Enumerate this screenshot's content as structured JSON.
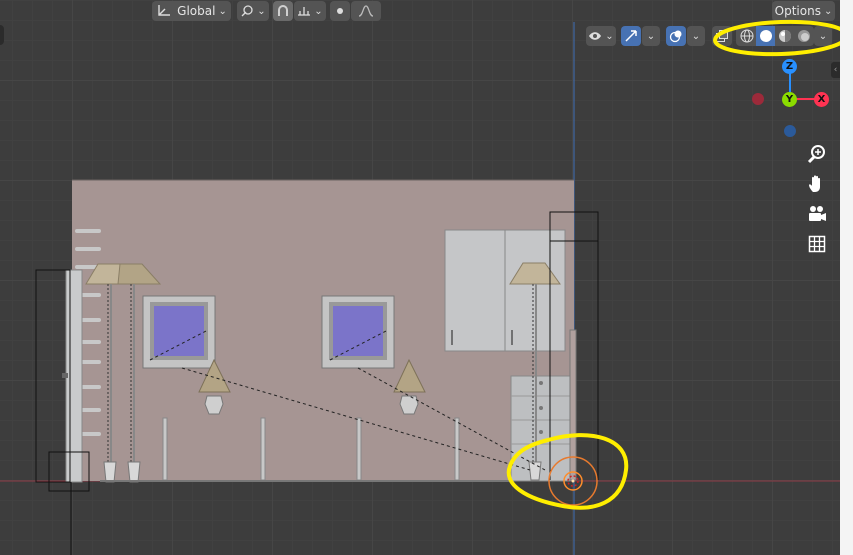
{
  "header": {
    "transform_orientation": "Global",
    "options_label": "Options"
  },
  "axes": {
    "z": "Z",
    "y": "Y",
    "x": "X"
  },
  "colors": {
    "highlight": "#ffee00",
    "axis_x": "#ff3352",
    "axis_y": "#8bdc00",
    "axis_z": "#2890ff",
    "wall": "#a69593"
  }
}
